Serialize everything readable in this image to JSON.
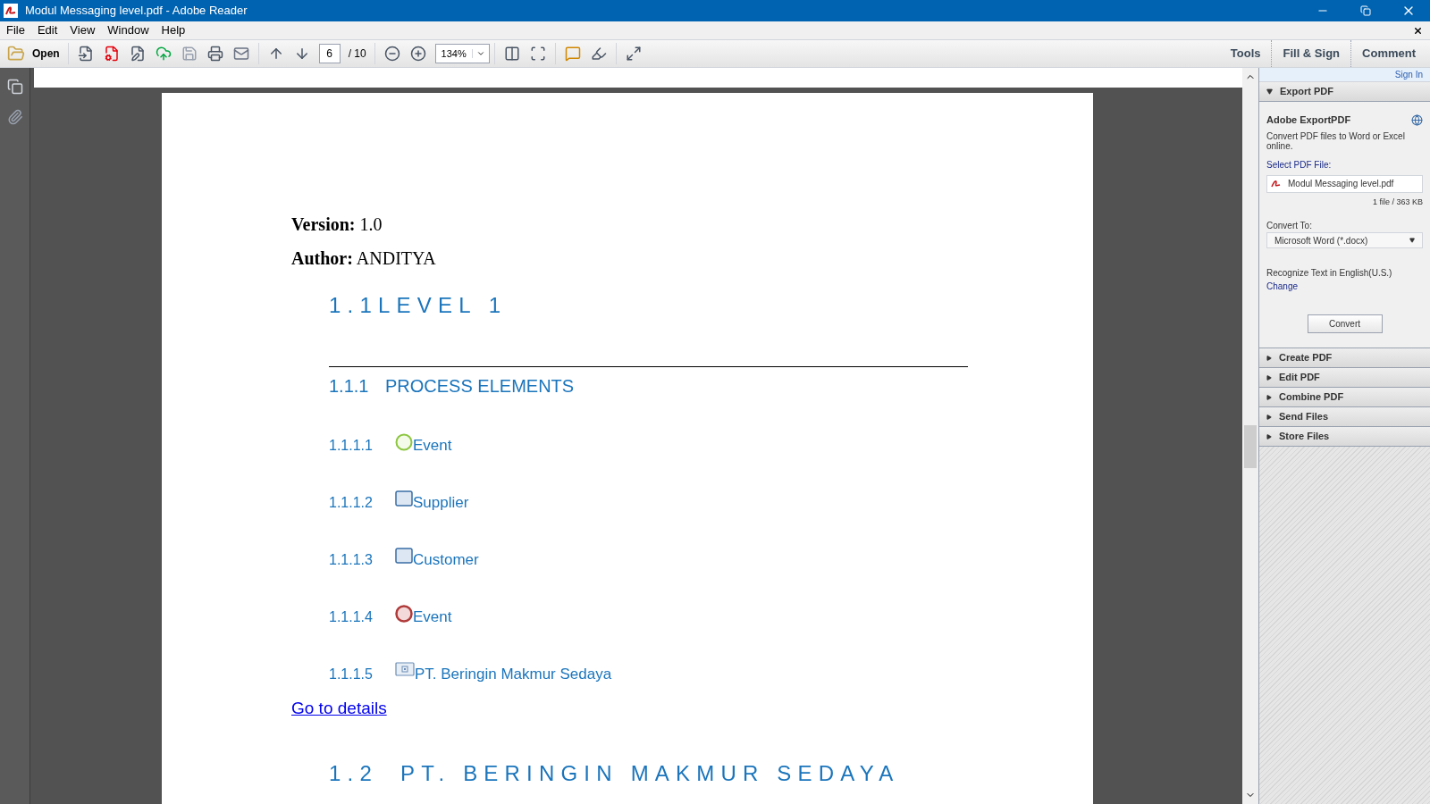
{
  "window": {
    "title": "Modul Messaging level.pdf - Adobe Reader"
  },
  "menu": [
    "File",
    "Edit",
    "View",
    "Window",
    "Help"
  ],
  "toolbar": {
    "open_label": "Open",
    "page": "6",
    "page_total": "/ 10",
    "zoom": "134%"
  },
  "toolbar_tabs": [
    "Tools",
    "Fill & Sign",
    "Comment"
  ],
  "document": {
    "version_label": "Version:",
    "version": "1.0",
    "author_label": "Author:",
    "author": "ANDITYA",
    "heading": "1.1LEVEL 1",
    "subheading_number": "1.1.1",
    "subheading": "PROCESS ELEMENTS",
    "items": [
      {
        "number": "1.1.1.1",
        "kind": "start",
        "label": "Event"
      },
      {
        "number": "1.1.1.2",
        "kind": "task",
        "label": "Supplier"
      },
      {
        "number": "1.1.1.3",
        "kind": "task",
        "label": "Customer"
      },
      {
        "number": "1.1.1.4",
        "kind": "end",
        "label": "Event"
      },
      {
        "number": "1.1.1.5",
        "kind": "subprocess",
        "label": "PT. Beringin Makmur Sedaya"
      }
    ],
    "link": "Go to details",
    "next_heading_number": "1.2",
    "next_heading": "PT. BERINGIN MAKMUR SEDAYA"
  },
  "panel": {
    "sign_in": "Sign In",
    "export": {
      "title": "Export PDF",
      "expanded": true,
      "service": "Adobe ExportPDF",
      "description": "Convert PDF files to Word or Excel online.",
      "select_label": "Select PDF File:",
      "file": "Modul Messaging level.pdf",
      "file_info": "1 file / 363 KB",
      "convert_label": "Convert To:",
      "convert_value": "Microsoft Word (*.docx)",
      "recognize": "Recognize Text in English(U.S.)",
      "change": "Change",
      "button": "Convert"
    },
    "sections": [
      {
        "title": "Create PDF",
        "expanded": false
      },
      {
        "title": "Edit PDF",
        "expanded": false
      },
      {
        "title": "Combine PDF",
        "expanded": false
      },
      {
        "title": "Send Files",
        "expanded": false
      },
      {
        "title": "Store Files",
        "expanded": false
      }
    ]
  }
}
